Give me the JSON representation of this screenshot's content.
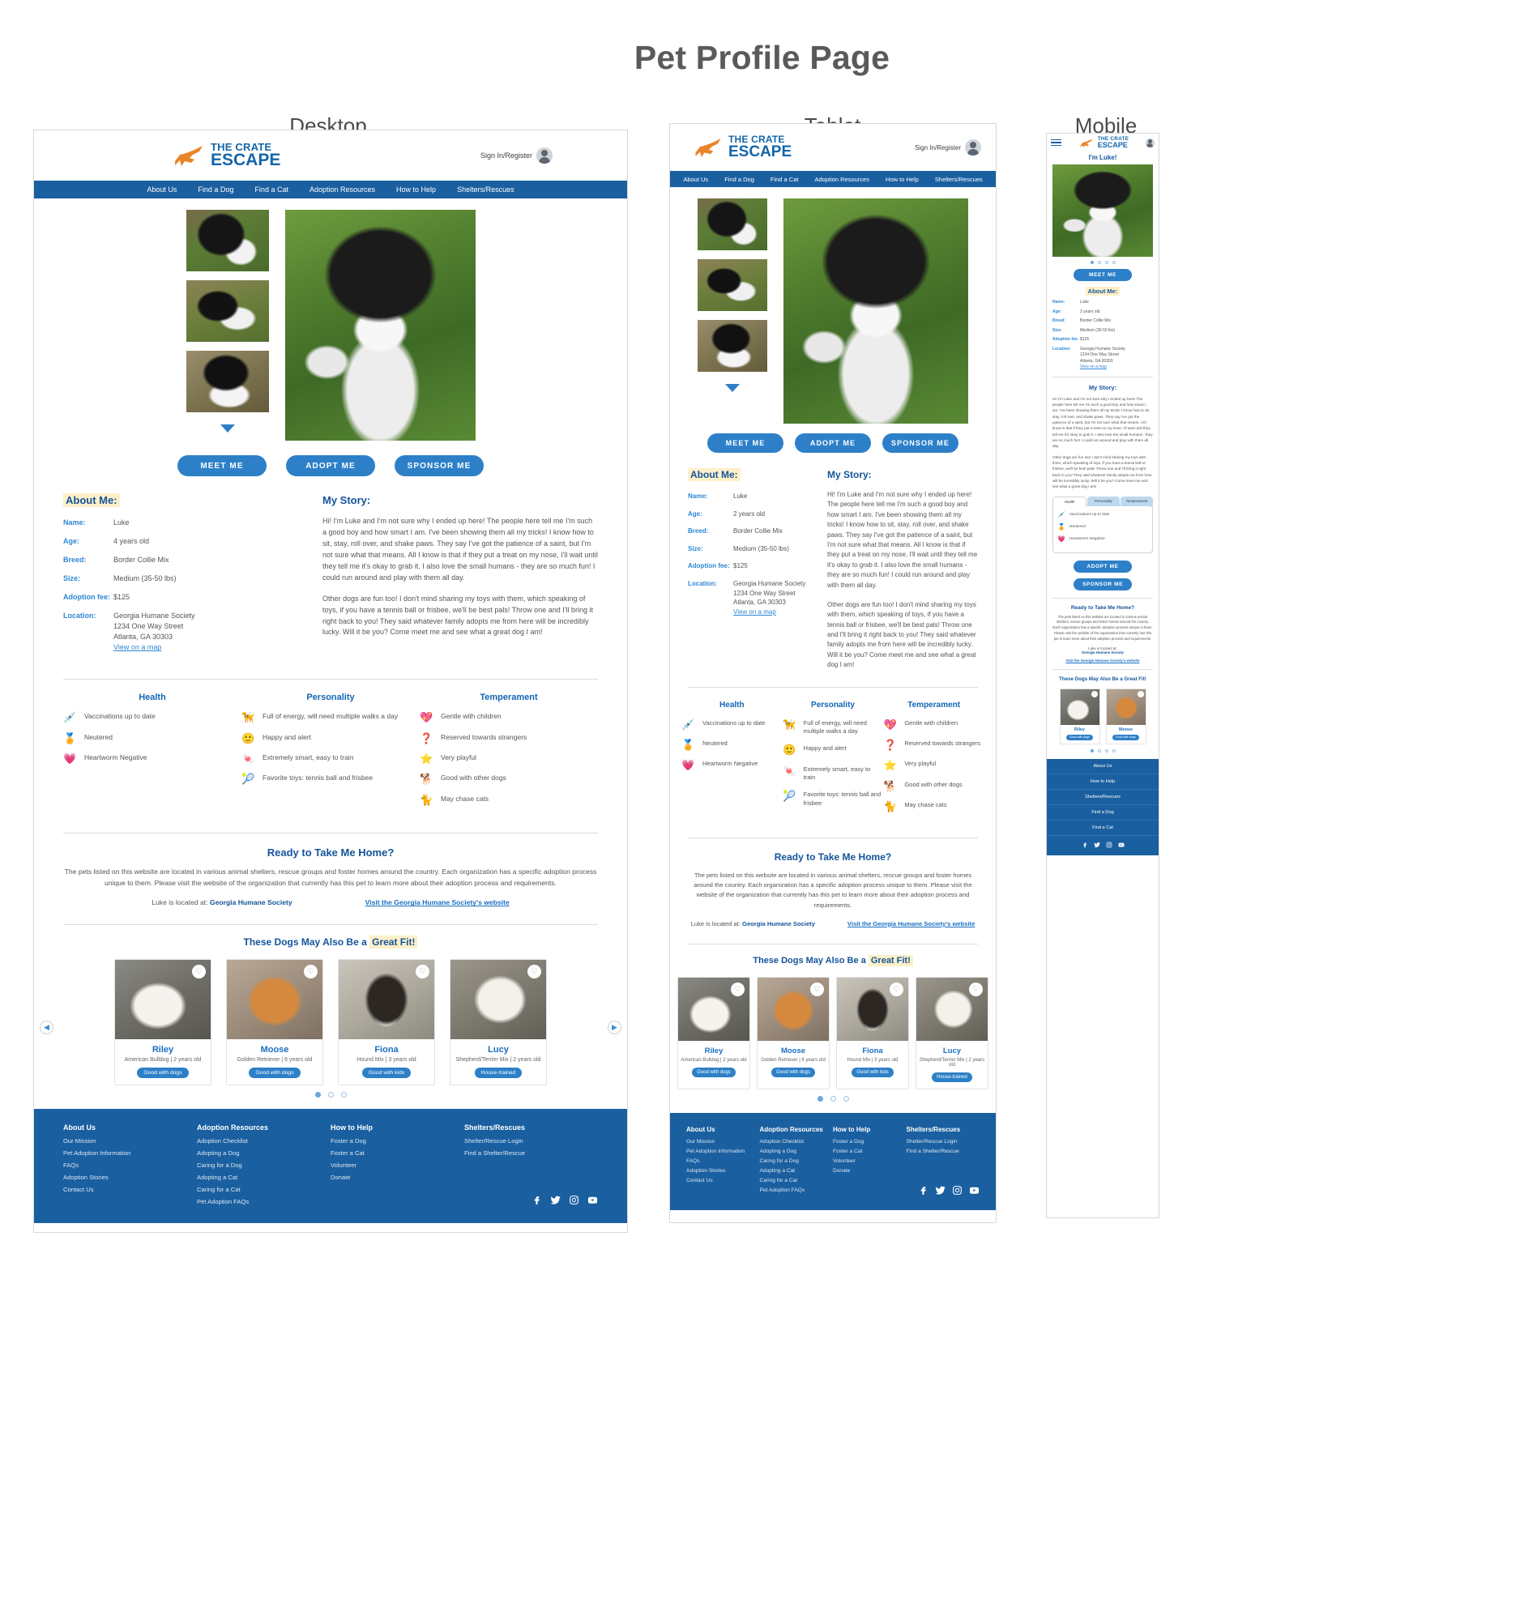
{
  "page": {
    "title": "Pet Profile Page"
  },
  "breakpoint_labels": {
    "desktop": "Desktop",
    "tablet": "Tablet",
    "mobile": "Mobile"
  },
  "brand": {
    "line1": "THE CRATE",
    "line2": "ESCAPE",
    "accent": "#e8852a",
    "blue": "#1466a8"
  },
  "header": {
    "signin": "Sign In/Register",
    "avatar_icon": "user-avatar-icon",
    "menu_icon": "hamburger-menu-icon"
  },
  "nav": {
    "items": [
      "About Us",
      "Find a Dog",
      "Find a Cat",
      "Adoption Resources",
      "How to Help",
      "Shelters/Rescues"
    ]
  },
  "gallery": {
    "thumbs": [
      "pet-thumb-1",
      "pet-thumb-2",
      "pet-thumb-3"
    ],
    "hero": "pet-hero-photo",
    "more_icon": "chevron-down-icon",
    "mobile_dots": 4,
    "mobile_active_dot": 0
  },
  "cta": {
    "meet": "MEET ME",
    "adopt": "ADOPT ME",
    "sponsor": "SPONSOR ME"
  },
  "mobile_title": "I'm Luke!",
  "about": {
    "heading": "About Me:",
    "rows_desktop": [
      {
        "key": "Name:",
        "value": "Luke"
      },
      {
        "key": "Age:",
        "value": "4 years old"
      },
      {
        "key": "Breed:",
        "value": "Border Collie Mix"
      },
      {
        "key": "Size:",
        "value": "Medium (35-50 lbs)"
      },
      {
        "key": "Adoption fee:",
        "value": "$125"
      }
    ],
    "rows_small": [
      {
        "key": "Name:",
        "value": "Luke"
      },
      {
        "key": "Age:",
        "value": "2 years old"
      },
      {
        "key": "Breed:",
        "value": "Border Collie Mix"
      },
      {
        "key": "Size:",
        "value": "Medium (35-50 lbs)"
      },
      {
        "key": "Adoption fee:",
        "value": "$125"
      }
    ],
    "location_key": "Location:",
    "location_lines": [
      "Georgia Humane Society",
      "1234 One Way Street",
      "Atlanta, GA 30303"
    ],
    "map_link": "View on a map"
  },
  "story": {
    "heading": "My Story:",
    "p1": "Hi! I'm Luke and I'm not sure why I ended up here! The people here tell me I'm such a good boy and how smart I am. I've been showing them all my tricks! I know how to sit, stay, roll over, and shake paws. They say I've got the patience of a saint, but I'm not sure what that means. All I know is that if they put a treat on my nose, I'll wait until they tell me it's okay to grab it. I also love the small humans - they are so much fun! I could run around and play with them all day.",
    "p2": "Other dogs are fun too! I don't mind sharing my toys with them, which speaking of toys, if you have a tennis ball or frisbee, we'll be best pals! Throw one and I'll bring it right back to you! They said whatever family adopts me from here will be incredibly lucky. Will it be you? Come meet me and see what a great dog I am!"
  },
  "traits": {
    "tabs": [
      "Health",
      "Personality",
      "Temperament"
    ],
    "active_tab": "Health",
    "columns": [
      {
        "title": "Health",
        "items": [
          {
            "icon": "syringe-icon",
            "glyph": "💉",
            "label": "Vaccinations up to date"
          },
          {
            "icon": "award-rosette-icon",
            "glyph": "🏅",
            "label": "Neutered"
          },
          {
            "icon": "heartbeat-icon",
            "glyph": "💗",
            "label": "Heartworm Negative"
          }
        ]
      },
      {
        "title": "Personality",
        "items": [
          {
            "icon": "collar-leash-icon",
            "glyph": "🦮",
            "label": "Full of energy, will need multiple walks a day"
          },
          {
            "icon": "smiley-face-icon",
            "glyph": "🙂",
            "label": "Happy and alert"
          },
          {
            "icon": "treat-bag-icon",
            "glyph": "🍬",
            "label": "Extremely smart, easy to train"
          },
          {
            "icon": "tennis-ball-icon",
            "glyph": "🎾",
            "label": "Favorite toys: tennis ball and frisbee"
          }
        ]
      },
      {
        "title": "Temperament",
        "items": [
          {
            "icon": "heart-child-icon",
            "glyph": "💖",
            "label": "Gentle with children"
          },
          {
            "icon": "question-mark-icon",
            "glyph": "❓",
            "label": "Reserved towards strangers"
          },
          {
            "icon": "star-icon",
            "glyph": "⭐",
            "label": "Very playful"
          },
          {
            "icon": "dog-icon",
            "glyph": "🐕",
            "label": "Good with other dogs"
          },
          {
            "icon": "cat-icon",
            "glyph": "🐈",
            "label": "May chase cats"
          }
        ]
      }
    ]
  },
  "ready": {
    "heading": "Ready to Take Me Home?",
    "body": "The pets listed on this website are located in various animal shelters, rescue groups and foster homes around the country. Each organization has a specific adoption process unique to them. Please visit the website of the organization that currently has this pet to learn more about their adoption process and requirements.",
    "located_prefix": "Luke is located at:",
    "shelter": "Georgia Humane Society",
    "visit_link": "Visit the Georgia Humane Society's website",
    "visit_link_mobile": "Visit the Georgia Humane Society's website"
  },
  "suggested": {
    "heading": "These Dogs May Also Be a Great Fit!",
    "heading_highlight": "Great Fit!",
    "prev_icon": "chevron-left-icon",
    "next_icon": "chevron-right-icon",
    "favorite_icon": "heart-outline-icon",
    "dots": 3,
    "active_dot": 0,
    "mobile_dots": 4,
    "cards": [
      {
        "photo": "ph-riley",
        "name": "Riley",
        "meta": "American Bulldog | 2 years old",
        "badge": "Good with dogs"
      },
      {
        "photo": "ph-moose",
        "name": "Moose",
        "meta": "Golden Retriever | 6 years old",
        "badge": "Good with dogs"
      },
      {
        "photo": "ph-fiona",
        "name": "Fiona",
        "meta": "Hound Mix | 3 years old",
        "badge": "Good with kids"
      },
      {
        "photo": "ph-lucy",
        "name": "Lucy",
        "meta": "Shepherd/Terrier Mix | 2 years old",
        "badge": "House-trained"
      }
    ]
  },
  "footer": {
    "columns": [
      {
        "title": "About Us",
        "links": [
          "Our Mission",
          "Pet Adoption Information",
          "FAQs",
          "Adoption Stories",
          "Contact Us"
        ]
      },
      {
        "title": "Adoption Resources",
        "links": [
          "Adoption Checklist",
          "Adopting a Dog",
          "Caring for a Dog",
          "Adopting a Cat",
          "Caring for a Cat",
          "Pet Adoption FAQs"
        ]
      },
      {
        "title": "How to Help",
        "links": [
          "Foster a Dog",
          "Foster a Cat",
          "Volunteer",
          "Donate"
        ]
      },
      {
        "title": "Shelters/Rescues",
        "links": [
          "Shelter/Rescue Login",
          "Find a Shelter/Rescue"
        ]
      }
    ],
    "socials": [
      "facebook-icon",
      "twitter-icon",
      "instagram-icon",
      "youtube-icon"
    ]
  },
  "mobile_nav": {
    "items": [
      "About Us",
      "How to Help",
      "Shelters/Rescues",
      "Find a Dog",
      "Find a Cat"
    ]
  }
}
